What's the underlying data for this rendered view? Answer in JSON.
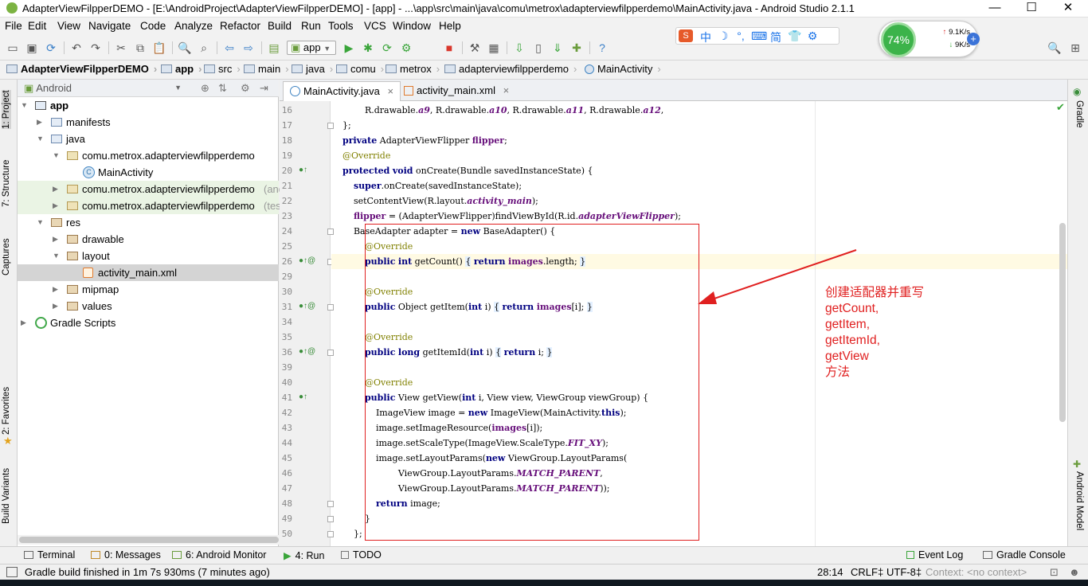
{
  "window": {
    "title": "AdapterViewFilpperDEMO - [E:\\AndroidProject\\AdapterViewFilpperDEMO] - [app] - ...\\app\\src\\main\\java\\comu\\metrox\\adapterviewfilpperdemo\\MainActivity.java - Android Studio 2.1.1",
    "minimize": "—",
    "maximize": "☐",
    "close": "✕"
  },
  "menu": [
    "File",
    "Edit",
    "View",
    "Navigate",
    "Code",
    "Analyze",
    "Refactor",
    "Build",
    "Run",
    "Tools",
    "VCS",
    "Window",
    "Help"
  ],
  "toolbar": {
    "run_config": "app",
    "icons": [
      "open-icon",
      "save-icon",
      "sync-icon",
      "undo-icon",
      "redo-icon",
      "cut-icon",
      "copy-icon",
      "paste-icon",
      "find-icon",
      "replace-icon",
      "back-icon",
      "forward-icon",
      "make-icon",
      "run-icon",
      "debug-icon",
      "attach-icon",
      "stop-icon",
      "project-structure-icon",
      "sdk-manager-icon",
      "avd-manager-icon",
      "android-device-monitor-icon",
      "help-icon",
      "search-icon",
      "layout-icon"
    ]
  },
  "ime": {
    "glyphs": [
      "中",
      "☽",
      "°,",
      "⌨",
      "简",
      "👕",
      "⚙"
    ]
  },
  "perf": {
    "cpu": "74%",
    "up": "9.1K/s",
    "down": "9K/s",
    "add": "+"
  },
  "breadcrumbs": [
    "AdapterViewFilpperDEMO",
    "app",
    "src",
    "main",
    "java",
    "comu",
    "metrox",
    "adapterviewfilpperdemo",
    "MainActivity"
  ],
  "left_strip": [
    "1: Project",
    "7: Structure",
    "Captures",
    "2: Favorites",
    "Build Variants"
  ],
  "right_strip": [
    "Gradle",
    "Android Model"
  ],
  "project": {
    "view": "Android",
    "tree": [
      {
        "label": "app",
        "indent": 0,
        "arrow": "▼",
        "icon": "module",
        "bold": true
      },
      {
        "label": "manifests",
        "indent": 1,
        "arrow": "▶",
        "icon": "folder"
      },
      {
        "label": "java",
        "indent": 1,
        "arrow": "▼",
        "icon": "folder"
      },
      {
        "label": "comu.metrox.adapterviewfilpperdemo",
        "indent": 2,
        "arrow": "▼",
        "icon": "package"
      },
      {
        "label": "MainActivity",
        "indent": 3,
        "arrow": "",
        "icon": "class"
      },
      {
        "label": "comu.metrox.adapterviewfilpperdemo",
        "suffix": "(and",
        "indent": 2,
        "arrow": "▶",
        "icon": "package",
        "hl": true
      },
      {
        "label": "comu.metrox.adapterviewfilpperdemo",
        "suffix": "(tes",
        "indent": 2,
        "arrow": "▶",
        "icon": "package",
        "hl": true
      },
      {
        "label": "res",
        "indent": 1,
        "arrow": "▼",
        "icon": "res"
      },
      {
        "label": "drawable",
        "indent": 2,
        "arrow": "▶",
        "icon": "res"
      },
      {
        "label": "layout",
        "indent": 2,
        "arrow": "▼",
        "icon": "res"
      },
      {
        "label": "activity_main.xml",
        "indent": 3,
        "arrow": "",
        "icon": "xml",
        "sel": true
      },
      {
        "label": "mipmap",
        "indent": 2,
        "arrow": "▶",
        "icon": "res"
      },
      {
        "label": "values",
        "indent": 2,
        "arrow": "▶",
        "icon": "res"
      },
      {
        "label": "Gradle Scripts",
        "indent": 0,
        "arrow": "▶",
        "icon": "gradle"
      }
    ]
  },
  "editor": {
    "tabs": [
      {
        "label": "MainActivity.java",
        "active": true
      },
      {
        "label": "activity_main.xml",
        "active": false
      }
    ],
    "close_glyph": "×",
    "line_numbers": [
      "16",
      "17",
      "18",
      "19",
      "20",
      "21",
      "22",
      "23",
      "24",
      "25",
      "26",
      "29",
      "30",
      "31",
      "34",
      "35",
      "36",
      "39",
      "40",
      "41",
      "42",
      "43",
      "44",
      "45",
      "46",
      "47",
      "48",
      "49",
      "50"
    ],
    "code": [
      "            R.drawable.a9, R.drawable.a10, R.drawable.a11, R.drawable.a12,",
      "    };",
      "    private AdapterViewFlipper flipper;",
      "    @Override",
      "    protected void onCreate(Bundle savedInstanceState) {",
      "        super.onCreate(savedInstanceState);",
      "        setContentView(R.layout.activity_main);",
      "        flipper = (AdapterViewFlipper)findViewById(R.id.adapterViewFlipper);",
      "        BaseAdapter adapter = new BaseAdapter() {",
      "            @Override",
      "            public int getCount() { return images.length; }",
      "",
      "            @Override",
      "            public Object getItem(int i) { return images[i]; }",
      "",
      "            @Override",
      "            public long getItemId(int i) { return i; }",
      "",
      "            @Override",
      "            public View getView(int i, View view, ViewGroup viewGroup) {",
      "                ImageView image = new ImageView(MainActivity.this);",
      "                image.setImageResource(images[i]);",
      "                image.setScaleType(ImageView.ScaleType.FIT_XY);",
      "                image.setLayoutParams(new ViewGroup.LayoutParams(",
      "                        ViewGroup.LayoutParams.MATCH_PARENT,",
      "                        ViewGroup.LayoutParams.MATCH_PARENT));",
      "                return image;",
      "            }",
      "        };"
    ]
  },
  "annotation": [
    "创建适配器并重写",
    "getCount,",
    "getItem,",
    "getItemId,",
    "getView",
    "方法"
  ],
  "bottom_tabs": [
    "Terminal",
    "0: Messages",
    "6: Android Monitor",
    "4: Run",
    "TODO",
    "Event Log",
    "Gradle Console"
  ],
  "status": {
    "message": "Gradle build finished in 1m 7s 930ms (7 minutes ago)",
    "position": "28:14",
    "line_sep": "CRLF‡",
    "encoding": "UTF-8‡",
    "context": "Context: <no context>"
  },
  "colors": {
    "keyword": "#000080",
    "annotation": "#808000",
    "field": "#660e7a",
    "annotation_box": "#e02020",
    "cpu_green": "#3cb34a"
  }
}
